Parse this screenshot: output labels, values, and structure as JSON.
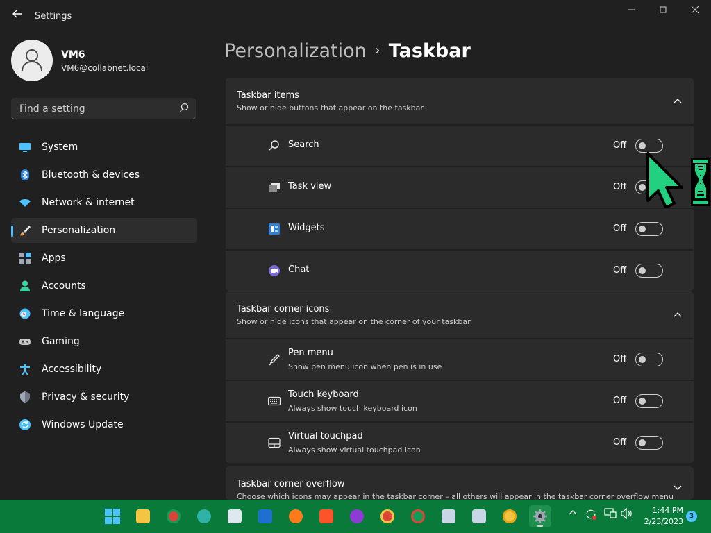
{
  "window": {
    "title": "Settings"
  },
  "profile": {
    "name": "VM6",
    "email": "VM6@collabnet.local"
  },
  "search": {
    "placeholder": "Find a setting"
  },
  "nav": {
    "items": [
      {
        "label": "System",
        "icon": "monitor-icon",
        "color": "#4cc2ff"
      },
      {
        "label": "Bluetooth & devices",
        "icon": "bluetooth-icon",
        "color": "#4cc2ff"
      },
      {
        "label": "Network & internet",
        "icon": "wifi-icon",
        "color": "#4cc2ff"
      },
      {
        "label": "Personalization",
        "icon": "brush-icon",
        "color": "#f7a55b",
        "active": true
      },
      {
        "label": "Apps",
        "icon": "apps-icon",
        "color": "#9ea7b3"
      },
      {
        "label": "Accounts",
        "icon": "person-icon",
        "color": "#3ad29f"
      },
      {
        "label": "Time & language",
        "icon": "clock-globe-icon",
        "color": "#4cc2ff"
      },
      {
        "label": "Gaming",
        "icon": "gamepad-icon",
        "color": "#c8c8c8"
      },
      {
        "label": "Accessibility",
        "icon": "accessibility-icon",
        "color": "#4cc2ff"
      },
      {
        "label": "Privacy & security",
        "icon": "shield-icon",
        "color": "#9ea7b3"
      },
      {
        "label": "Windows Update",
        "icon": "update-icon",
        "color": "#4cc2ff"
      }
    ]
  },
  "breadcrumb": {
    "parent": "Personalization",
    "separator": "›",
    "current": "Taskbar"
  },
  "sections": {
    "items": {
      "title": "Taskbar items",
      "subtitle": "Show or hide buttons that appear on the taskbar",
      "rows": [
        {
          "label": "Search",
          "state": "Off",
          "icon": "search-icon"
        },
        {
          "label": "Task view",
          "state": "Off",
          "icon": "task-view-icon"
        },
        {
          "label": "Widgets",
          "state": "Off",
          "icon": "widgets-icon"
        },
        {
          "label": "Chat",
          "state": "Off",
          "icon": "chat-icon"
        }
      ]
    },
    "corner": {
      "title": "Taskbar corner icons",
      "subtitle": "Show or hide icons that appear on the corner of your taskbar",
      "rows": [
        {
          "label": "Pen menu",
          "desc": "Show pen menu icon when pen is in use",
          "state": "Off",
          "icon": "pen-icon"
        },
        {
          "label": "Touch keyboard",
          "desc": "Always show touch keyboard icon",
          "state": "Off",
          "icon": "keyboard-icon"
        },
        {
          "label": "Virtual touchpad",
          "desc": "Always show virtual touchpad icon",
          "state": "Off",
          "icon": "touchpad-icon"
        }
      ]
    },
    "overflow": {
      "title": "Taskbar corner overflow",
      "subtitle": "Choose which icons may appear in the taskbar corner – all others will appear in the taskbar corner overflow menu"
    }
  },
  "taskbar": {
    "time": "1:44 PM",
    "date": "2/23/2023",
    "notification_count": "3",
    "accent": "#0a7a3a"
  }
}
